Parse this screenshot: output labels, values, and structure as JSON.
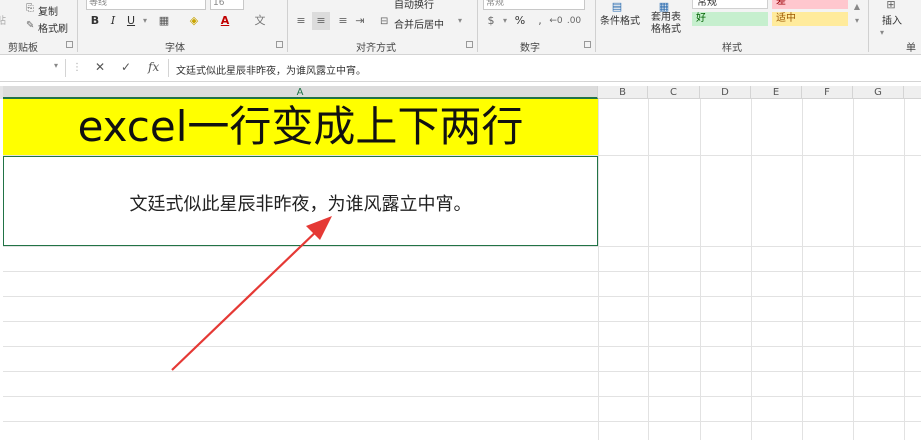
{
  "ribbon": {
    "clipboard": {
      "copy_label": "复制",
      "format_painter_label": "格式刷",
      "group_label": "剪贴板",
      "paste_fragment": "贴"
    },
    "font": {
      "group_label": "字体",
      "font_name": "等线",
      "font_size": "16",
      "bold": "B",
      "italic": "I",
      "underline": "U",
      "font_color_glyph": "A"
    },
    "alignment": {
      "group_label": "对齐方式",
      "wrap_text_label": "自动换行",
      "merge_center_label": "合并后居中"
    },
    "number": {
      "group_label": "数字",
      "format": "常规",
      "percent": "%"
    },
    "styles": {
      "group_label": "样式",
      "conditional_format_label": "条件格式",
      "table_format_label": "套用表格格式",
      "normal_label": "常规",
      "bad_label": "差",
      "good_label": "好",
      "neutral_label": "适中",
      "colors": {
        "good_bg": "#c6efce",
        "good_fg": "#006100",
        "neutral_bg": "#ffeb9c",
        "neutral_fg": "#9c5700",
        "bad_bg": "#ffc7ce"
      }
    },
    "cells": {
      "insert_label": "插入",
      "group_fragment": "单"
    }
  },
  "formula_bar": {
    "cancel_glyph": "✕",
    "enter_glyph": "✓",
    "fx_label": "fx",
    "content": "文廷式似此星辰非昨夜，为谁风露立中宵。"
  },
  "sheet": {
    "columns": [
      "A",
      "B",
      "C",
      "D",
      "E",
      "F",
      "G"
    ],
    "title_cell": "excel一行变成上下两行",
    "title_bg": "#ffff00",
    "text_cell": "文廷式似此星辰非昨夜，为谁风露立中宵。",
    "selection_color": "#217346"
  },
  "annotation": {
    "arrow_color": "#e53935"
  }
}
